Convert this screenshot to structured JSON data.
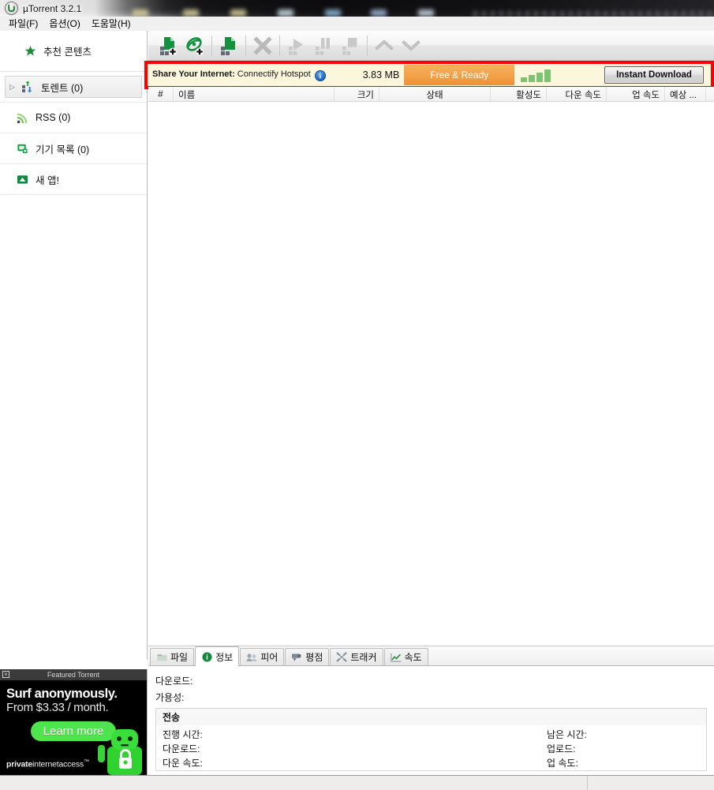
{
  "window": {
    "title": "µTorrent 3.2.1",
    "logo_icon": "utorrent-logo-icon"
  },
  "menu": {
    "items": [
      {
        "label": "파일(F)",
        "name": "menu-file"
      },
      {
        "label": "옵션(O)",
        "name": "menu-options"
      },
      {
        "label": "도움말(H)",
        "name": "menu-help"
      }
    ]
  },
  "toolbar": {
    "buttons": [
      {
        "name": "add-torrent-button",
        "icon": "add-torrent-file-icon",
        "enabled": true
      },
      {
        "name": "add-torrent-from-url-button",
        "icon": "add-torrent-url-globe-icon",
        "enabled": true
      },
      {
        "name": "create-new-torrent-button",
        "icon": "new-torrent-file-icon",
        "enabled": true
      },
      {
        "name": "remove-torrent-button",
        "icon": "remove-x-icon",
        "enabled": false
      },
      {
        "name": "start-torrent-button",
        "icon": "play-icon",
        "enabled": false
      },
      {
        "name": "pause-torrent-button",
        "icon": "pause-icon",
        "enabled": false
      },
      {
        "name": "stop-torrent-button",
        "icon": "stop-icon",
        "enabled": false
      },
      {
        "name": "move-up-button",
        "icon": "chevron-up-icon",
        "enabled": false
      },
      {
        "name": "move-down-button",
        "icon": "chevron-down-icon",
        "enabled": false
      }
    ]
  },
  "sidebar": {
    "items": [
      {
        "name": "sidebar-item-featured-content",
        "label": "추천 콘텐츠",
        "icon": "star-icon",
        "selected": false,
        "caret": false
      },
      {
        "name": "sidebar-item-torrents",
        "label": "토렌트 (0)",
        "icon": "torrents-arrows-icon",
        "selected": true,
        "caret": true
      },
      {
        "name": "sidebar-item-rss",
        "label": "RSS (0)",
        "icon": "rss-icon",
        "selected": false,
        "caret": false
      },
      {
        "name": "sidebar-item-devices",
        "label": "기기 목록 (0)",
        "icon": "device-icon",
        "selected": false,
        "caret": false
      },
      {
        "name": "sidebar-item-new-apps",
        "label": "새 앱!",
        "icon": "apps-icon",
        "selected": false,
        "caret": false
      }
    ]
  },
  "sidebar_ad": {
    "header": "Featured Torrent",
    "close_icon": "close-icon",
    "line1": "Surf anonymously.",
    "line2": "From $3.33 / month.",
    "cta": "Learn more",
    "brand_bold": "private",
    "brand_rest": "internetaccess",
    "brand_tm": "™",
    "mascot_icon": "pia-robot-mascot-icon"
  },
  "connectify_banner": {
    "label_bold": "Share Your Internet:",
    "label_rest": " Connectify Hotspot",
    "info_icon": "info-icon",
    "size": "3.83 MB",
    "status_button": "Free & Ready",
    "signal_icon": "signal-bars-icon",
    "signal_bars": [
      6,
      9,
      12,
      16
    ],
    "download_button": "Instant Download",
    "border_color": "#fe0000",
    "status_color": "#f3a24a"
  },
  "torrent_list": {
    "columns": [
      {
        "name": "column-index",
        "label": "#"
      },
      {
        "name": "column-name",
        "label": "이름"
      },
      {
        "name": "column-size",
        "label": "크기"
      },
      {
        "name": "column-status",
        "label": "상태"
      },
      {
        "name": "column-activity",
        "label": "활성도"
      },
      {
        "name": "column-down-speed",
        "label": "다운 속도"
      },
      {
        "name": "column-up-speed",
        "label": "업 속도"
      },
      {
        "name": "column-eta",
        "label": "예상 ..."
      }
    ],
    "rows": []
  },
  "detail_tabs": [
    {
      "name": "tab-files",
      "label": "파일",
      "icon": "folder-icon",
      "active": false
    },
    {
      "name": "tab-info",
      "label": "정보",
      "icon": "info-circle-icon",
      "active": true
    },
    {
      "name": "tab-peers",
      "label": "피어",
      "icon": "peers-icon",
      "active": false
    },
    {
      "name": "tab-ratings",
      "label": "평점",
      "icon": "ratings-icon",
      "active": false
    },
    {
      "name": "tab-trackers",
      "label": "트래커",
      "icon": "trackers-icon",
      "active": false
    },
    {
      "name": "tab-speed",
      "label": "속도",
      "icon": "speed-chart-icon",
      "active": false
    }
  ],
  "detail_panel": {
    "downloaded_label": "다운로드:",
    "downloaded_value": "",
    "availability_label": "가용성:",
    "availability_value": "",
    "transfer_section": "전송",
    "left": [
      {
        "label": "진행 시간:",
        "value": ""
      },
      {
        "label": "다운로드:",
        "value": ""
      },
      {
        "label": "다운 속도:",
        "value": ""
      }
    ],
    "right": [
      {
        "label": "남은 시간:",
        "value": ""
      },
      {
        "label": "업로드:",
        "value": ""
      },
      {
        "label": "업 속도:",
        "value": ""
      }
    ]
  },
  "statusbar": {
    "left": "",
    "right": ""
  }
}
